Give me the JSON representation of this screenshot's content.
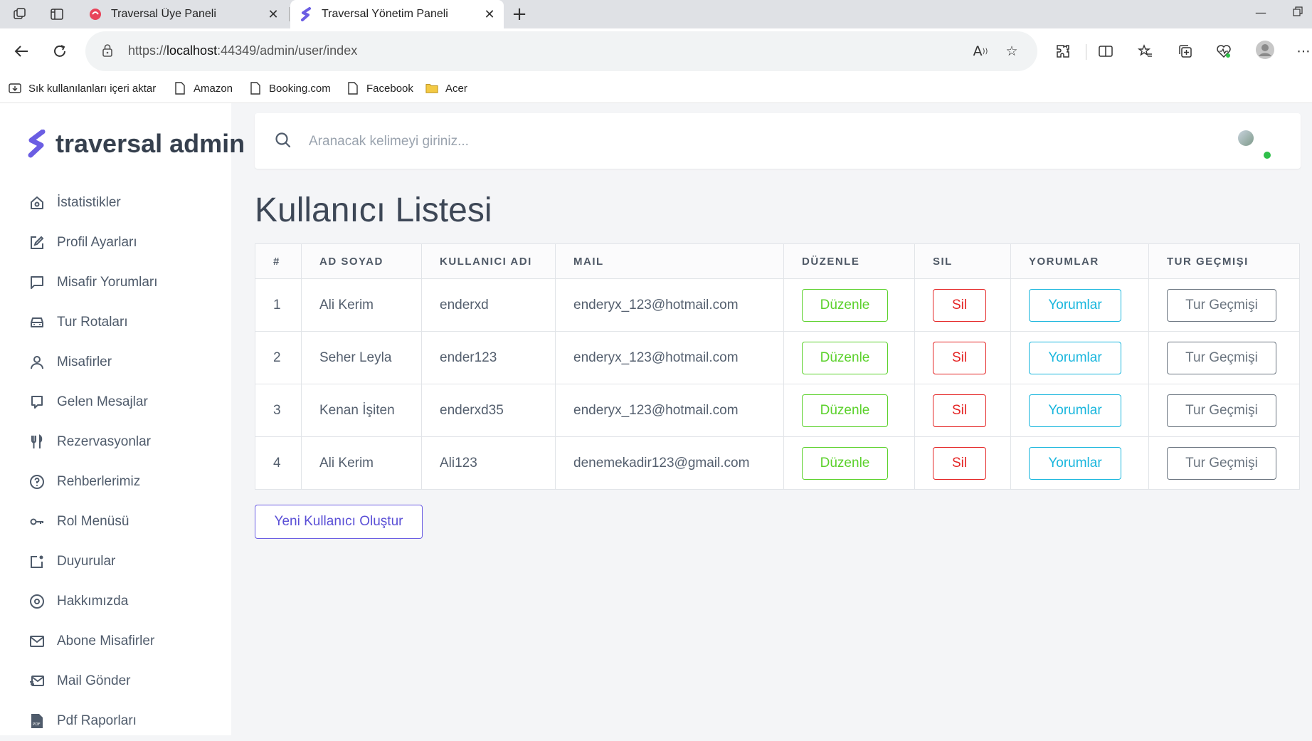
{
  "browser": {
    "tabs": [
      {
        "title": "Traversal Üye Paneli",
        "active": false
      },
      {
        "title": "Traversal Yönetim Paneli",
        "active": true
      }
    ],
    "url_prefix": "https://",
    "url_host": "localhost",
    "url_rest": ":44349/admin/user/index",
    "bookmarks": [
      {
        "label": "Sık kullanılanları içeri aktar",
        "icon": "import-icon"
      },
      {
        "label": "Amazon",
        "icon": "page-icon"
      },
      {
        "label": "Booking.com",
        "icon": "page-icon"
      },
      {
        "label": "Facebook",
        "icon": "page-icon"
      },
      {
        "label": "Acer",
        "icon": "folder-icon"
      }
    ]
  },
  "sidebar": {
    "brand": "traversal admin",
    "items": [
      {
        "label": "İstatistikler",
        "icon": "home-icon"
      },
      {
        "label": "Profil Ayarları",
        "icon": "edit-icon"
      },
      {
        "label": "Misafir Yorumları",
        "icon": "message-square-icon"
      },
      {
        "label": "Tur Rotaları",
        "icon": "car-icon"
      },
      {
        "label": "Misafirler",
        "icon": "user-icon"
      },
      {
        "label": "Gelen Mesajlar",
        "icon": "chat-icon"
      },
      {
        "label": "Rezervasyonlar",
        "icon": "utensils-icon"
      },
      {
        "label": "Rehberlerimiz",
        "icon": "help-circle-icon"
      },
      {
        "label": "Rol Menüsü",
        "icon": "key-icon"
      },
      {
        "label": "Duyurular",
        "icon": "notification-icon"
      },
      {
        "label": "Hakkımızda",
        "icon": "disc-icon"
      },
      {
        "label": "Abone Misafirler",
        "icon": "mail-icon"
      },
      {
        "label": "Mail Gönder",
        "icon": "mail-send-icon"
      },
      {
        "label": "Pdf Raporları",
        "icon": "pdf-icon"
      }
    ]
  },
  "search": {
    "placeholder": "Aranacak kelimeyi giriniz..."
  },
  "page": {
    "title": "Kullanıcı Listesi"
  },
  "table": {
    "headers": [
      "#",
      "AD SOYAD",
      "KULLANICI ADI",
      "MAIL",
      "DÜZENLE",
      "SIL",
      "YORUMLAR",
      "TUR GEÇMIŞI"
    ],
    "rows": [
      {
        "id": "1",
        "name": "Ali Kerim",
        "username": "enderxd",
        "mail": "enderyx_123@hotmail.com"
      },
      {
        "id": "2",
        "name": "Seher Leyla",
        "username": "ender123",
        "mail": "enderyx_123@hotmail.com"
      },
      {
        "id": "3",
        "name": "Kenan İşiten",
        "username": "enderxd35",
        "mail": "enderyx_123@hotmail.com"
      },
      {
        "id": "4",
        "name": "Ali Kerim",
        "username": "Ali123",
        "mail": "denemekadir123@gmail.com"
      }
    ],
    "buttons": {
      "edit": "Düzenle",
      "delete": "Sil",
      "comments": "Yorumlar",
      "history": "Tur Geçmişi"
    }
  },
  "new_user_button": "Yeni Kullanıcı Oluştur",
  "colors": {
    "edit": "#5bd12b",
    "delete": "#e42424",
    "comments": "#19b6dd",
    "history": "#6b7580",
    "primary": "#6b5ee3",
    "online": "#2fbf4a"
  }
}
